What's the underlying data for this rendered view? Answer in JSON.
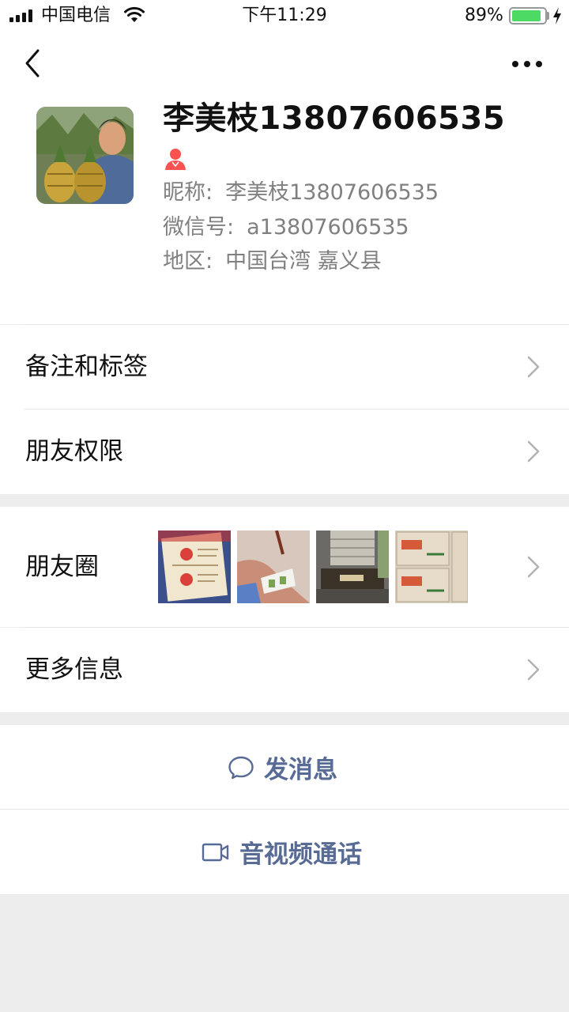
{
  "status_bar": {
    "carrier": "中国电信",
    "time": "下午11:29",
    "battery_percent": "89%",
    "battery_level": 0.89
  },
  "header": {
    "back_icon": "chevron-left-icon",
    "more_icon": "more-dots-icon"
  },
  "profile": {
    "name": "李美枝13807606535",
    "gender_icon": "female-icon",
    "gender_color": "#fa5151",
    "nickname_label": "昵称:",
    "nickname": "李美枝13807606535",
    "wechat_id_label": "微信号:",
    "wechat_id": "a13807606535",
    "region_label": "地区:",
    "region": "中国台湾 嘉义县"
  },
  "rows": {
    "remark_tags": "备注和标签",
    "friend_permissions": "朋友权限",
    "moments": "朋友圈",
    "more_info": "更多信息"
  },
  "actions": {
    "send_message": "发消息",
    "send_message_icon": "chat-bubble-icon",
    "av_call": "音视频通话",
    "av_call_icon": "video-camera-icon",
    "link_color": "#576b95"
  }
}
